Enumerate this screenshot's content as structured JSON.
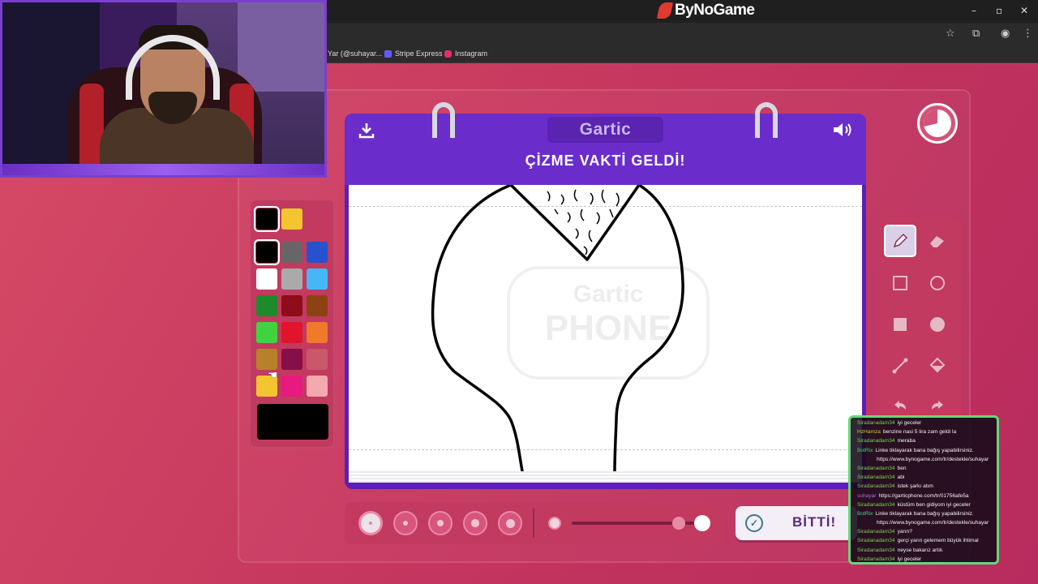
{
  "browser": {
    "brand": "ByNoGame",
    "window_controls": [
      "–",
      "▫",
      "✕"
    ],
    "bookmarks": [
      {
        "label": "Yar (@suhayar...",
        "color": "#2b2b2b"
      },
      {
        "label": "Stripe Express",
        "color": "#635bff"
      },
      {
        "label": "Instagram",
        "color": "#e1306c"
      }
    ]
  },
  "game": {
    "logo": "Gartic",
    "prompt": "ÇİZME VAKTİ GELDİ!",
    "watermark_top": "Gartic",
    "watermark_bottom": "PHONE",
    "done_label": "BİTTİ!",
    "icons": {
      "download": "download-icon",
      "sound": "speaker-icon",
      "timer": "timer-icon"
    },
    "selected_color": "#000000",
    "palette_top": [
      "#000000",
      "#f2c531"
    ],
    "palette_grid": [
      "#000000",
      "#666666",
      "#2752cf",
      "#ffffff",
      "#aaaaaa",
      "#45b7f5",
      "#1f8a2a",
      "#8f0c1a",
      "#8c4212",
      "#3fd43f",
      "#e0142a",
      "#f0792a",
      "#b7812a",
      "#870f47",
      "#c8586a",
      "#f2c531",
      "#e8197f",
      "#f3a9ae"
    ],
    "tools": [
      "pencil-icon",
      "eraser-icon",
      "rect-outline-icon",
      "circle-outline-icon",
      "rect-filled-icon",
      "circle-filled-icon",
      "line-icon",
      "fill-bucket-icon",
      "undo-icon",
      "redo-icon"
    ],
    "brush_sizes": [
      1,
      2,
      3,
      4,
      5
    ],
    "selected_brush_size": 1,
    "opacity_level": 1.0
  },
  "chat": [
    {
      "user": "Siradanadam34",
      "color": "#7ad14a",
      "msg": "iyi geceler"
    },
    {
      "user": "HzHamza",
      "color": "#d3c92a",
      "msg": "benzine nasi 5 lira zam geldi la"
    },
    {
      "user": "Siradanadam34",
      "color": "#7ad14a",
      "msg": "meraba"
    },
    {
      "user": "BotRix",
      "color": "#4ad178",
      "msg": "Linke tiklayarak bana bağış yapabilirsiniz."
    },
    {
      "user": "",
      "color": "#ffffff",
      "msg": "https://www.bynogame.com/tr/destekle/suhayar"
    },
    {
      "user": "Siradanadam34",
      "color": "#7ad14a",
      "msg": "ben"
    },
    {
      "user": "Siradanadam34",
      "color": "#7ad14a",
      "msg": "abi"
    },
    {
      "user": "Siradanadam34",
      "color": "#7ad14a",
      "msg": "istek şarkı atım"
    },
    {
      "user": "suhayar",
      "color": "#b46ad8",
      "msg": "https://garticphone.com/tr/01756afe5a"
    },
    {
      "user": "Siradanadam34",
      "color": "#7ad14a",
      "msg": "küstüm ben gidiyom iyi geceler"
    },
    {
      "user": "BotRix",
      "color": "#4ad178",
      "msg": "Linke tiklayarak bana bağış yapabilirsiniz."
    },
    {
      "user": "",
      "color": "#ffffff",
      "msg": "https://www.bynogame.com/tr/destekle/suhayar"
    },
    {
      "user": "Siradanadam34",
      "color": "#7ad14a",
      "msg": "yarın?"
    },
    {
      "user": "Siradanadam34",
      "color": "#7ad14a",
      "msg": "gerçi yarın gelemem büyük ihtimal"
    },
    {
      "user": "Siradanadam34",
      "color": "#7ad14a",
      "msg": "neyse bakarız artık"
    },
    {
      "user": "Siradanadam34",
      "color": "#7ad14a",
      "msg": "iyi geceler"
    }
  ]
}
